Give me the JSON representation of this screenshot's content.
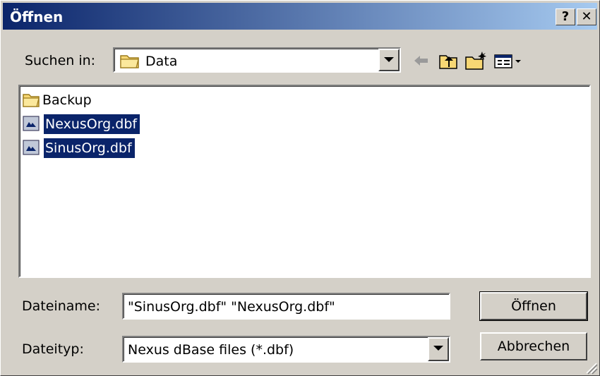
{
  "window": {
    "title": "Öffnen",
    "help_label": "?",
    "close_label": "✕"
  },
  "lookin": {
    "label": "Suchen in:",
    "value": "Data"
  },
  "toolbar": {
    "icons": [
      "back-arrow-icon",
      "up-folder-icon",
      "new-folder-icon",
      "view-menu-icon"
    ]
  },
  "files": [
    {
      "name": "Backup",
      "type": "folder",
      "selected": false
    },
    {
      "name": "NexusOrg.dbf",
      "type": "dbf",
      "selected": true
    },
    {
      "name": "SinusOrg.dbf",
      "type": "dbf",
      "selected": true
    }
  ],
  "filename": {
    "label": "Dateiname:",
    "value": "\"SinusOrg.dbf\" \"NexusOrg.dbf\""
  },
  "filetype": {
    "label": "Dateityp:",
    "value": "Nexus dBase files (*.dbf)"
  },
  "buttons": {
    "open": "Öffnen",
    "cancel": "Abbrechen"
  },
  "colors": {
    "title_start": "#0a246a",
    "title_end": "#a6caf0",
    "face": "#d4d0c8",
    "selection": "#0a246a"
  }
}
